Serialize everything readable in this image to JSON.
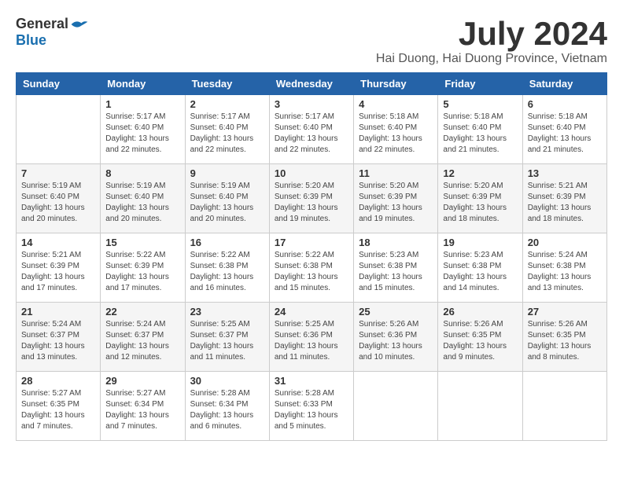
{
  "header": {
    "logo_general": "General",
    "logo_blue": "Blue",
    "month": "July 2024",
    "location": "Hai Duong, Hai Duong Province, Vietnam"
  },
  "days_of_week": [
    "Sunday",
    "Monday",
    "Tuesday",
    "Wednesday",
    "Thursday",
    "Friday",
    "Saturday"
  ],
  "weeks": [
    [
      {
        "day": null
      },
      {
        "day": "1",
        "sunrise": "5:17 AM",
        "sunset": "6:40 PM",
        "daylight": "13 hours and 22 minutes."
      },
      {
        "day": "2",
        "sunrise": "5:17 AM",
        "sunset": "6:40 PM",
        "daylight": "13 hours and 22 minutes."
      },
      {
        "day": "3",
        "sunrise": "5:17 AM",
        "sunset": "6:40 PM",
        "daylight": "13 hours and 22 minutes."
      },
      {
        "day": "4",
        "sunrise": "5:18 AM",
        "sunset": "6:40 PM",
        "daylight": "13 hours and 22 minutes."
      },
      {
        "day": "5",
        "sunrise": "5:18 AM",
        "sunset": "6:40 PM",
        "daylight": "13 hours and 21 minutes."
      },
      {
        "day": "6",
        "sunrise": "5:18 AM",
        "sunset": "6:40 PM",
        "daylight": "13 hours and 21 minutes."
      }
    ],
    [
      {
        "day": "7",
        "sunrise": "5:19 AM",
        "sunset": "6:40 PM",
        "daylight": "13 hours and 20 minutes."
      },
      {
        "day": "8",
        "sunrise": "5:19 AM",
        "sunset": "6:40 PM",
        "daylight": "13 hours and 20 minutes."
      },
      {
        "day": "9",
        "sunrise": "5:19 AM",
        "sunset": "6:40 PM",
        "daylight": "13 hours and 20 minutes."
      },
      {
        "day": "10",
        "sunrise": "5:20 AM",
        "sunset": "6:39 PM",
        "daylight": "13 hours and 19 minutes."
      },
      {
        "day": "11",
        "sunrise": "5:20 AM",
        "sunset": "6:39 PM",
        "daylight": "13 hours and 19 minutes."
      },
      {
        "day": "12",
        "sunrise": "5:20 AM",
        "sunset": "6:39 PM",
        "daylight": "13 hours and 18 minutes."
      },
      {
        "day": "13",
        "sunrise": "5:21 AM",
        "sunset": "6:39 PM",
        "daylight": "13 hours and 18 minutes."
      }
    ],
    [
      {
        "day": "14",
        "sunrise": "5:21 AM",
        "sunset": "6:39 PM",
        "daylight": "13 hours and 17 minutes."
      },
      {
        "day": "15",
        "sunrise": "5:22 AM",
        "sunset": "6:39 PM",
        "daylight": "13 hours and 17 minutes."
      },
      {
        "day": "16",
        "sunrise": "5:22 AM",
        "sunset": "6:38 PM",
        "daylight": "13 hours and 16 minutes."
      },
      {
        "day": "17",
        "sunrise": "5:22 AM",
        "sunset": "6:38 PM",
        "daylight": "13 hours and 15 minutes."
      },
      {
        "day": "18",
        "sunrise": "5:23 AM",
        "sunset": "6:38 PM",
        "daylight": "13 hours and 15 minutes."
      },
      {
        "day": "19",
        "sunrise": "5:23 AM",
        "sunset": "6:38 PM",
        "daylight": "13 hours and 14 minutes."
      },
      {
        "day": "20",
        "sunrise": "5:24 AM",
        "sunset": "6:38 PM",
        "daylight": "13 hours and 13 minutes."
      }
    ],
    [
      {
        "day": "21",
        "sunrise": "5:24 AM",
        "sunset": "6:37 PM",
        "daylight": "13 hours and 13 minutes."
      },
      {
        "day": "22",
        "sunrise": "5:24 AM",
        "sunset": "6:37 PM",
        "daylight": "13 hours and 12 minutes."
      },
      {
        "day": "23",
        "sunrise": "5:25 AM",
        "sunset": "6:37 PM",
        "daylight": "13 hours and 11 minutes."
      },
      {
        "day": "24",
        "sunrise": "5:25 AM",
        "sunset": "6:36 PM",
        "daylight": "13 hours and 11 minutes."
      },
      {
        "day": "25",
        "sunrise": "5:26 AM",
        "sunset": "6:36 PM",
        "daylight": "13 hours and 10 minutes."
      },
      {
        "day": "26",
        "sunrise": "5:26 AM",
        "sunset": "6:35 PM",
        "daylight": "13 hours and 9 minutes."
      },
      {
        "day": "27",
        "sunrise": "5:26 AM",
        "sunset": "6:35 PM",
        "daylight": "13 hours and 8 minutes."
      }
    ],
    [
      {
        "day": "28",
        "sunrise": "5:27 AM",
        "sunset": "6:35 PM",
        "daylight": "13 hours and 7 minutes."
      },
      {
        "day": "29",
        "sunrise": "5:27 AM",
        "sunset": "6:34 PM",
        "daylight": "13 hours and 7 minutes."
      },
      {
        "day": "30",
        "sunrise": "5:28 AM",
        "sunset": "6:34 PM",
        "daylight": "13 hours and 6 minutes."
      },
      {
        "day": "31",
        "sunrise": "5:28 AM",
        "sunset": "6:33 PM",
        "daylight": "13 hours and 5 minutes."
      },
      {
        "day": null
      },
      {
        "day": null
      },
      {
        "day": null
      }
    ]
  ],
  "labels": {
    "sunrise": "Sunrise:",
    "sunset": "Sunset:",
    "daylight": "Daylight:"
  }
}
